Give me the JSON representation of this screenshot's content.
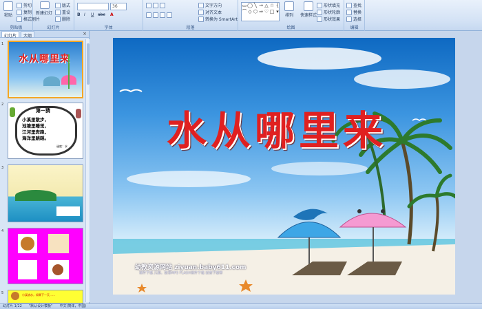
{
  "ribbon": {
    "clipboard": {
      "paste": "粘贴",
      "cut": "剪切",
      "copy": "复制",
      "format_painter": "格式刷",
      "label": "剪贴板"
    },
    "slides": {
      "new_slide": "新建幻灯片",
      "layout": "版式",
      "reset": "重设",
      "delete": "删除",
      "label": "幻灯片"
    },
    "font": {
      "font_name": "",
      "font_size": "36",
      "label": "字体"
    },
    "paragraph": {
      "text_direction": "文字方向",
      "align_text": "对齐文本",
      "smartart": "转换为 SmartArt",
      "label": "段落"
    },
    "drawing": {
      "arrange": "排列",
      "quick_styles": "快速样式",
      "fill": "形状填充",
      "outline": "形状轮廓",
      "effects": "形状效果",
      "label": "绘图"
    },
    "editing": {
      "find": "查找",
      "replace": "替换",
      "select": "选择",
      "label": "编辑"
    }
  },
  "panel": {
    "tabs": [
      "幻灯片",
      "大纲"
    ],
    "close": "×",
    "thumbs": [
      {
        "num": "1",
        "text": "水从哪里来"
      },
      {
        "num": "2",
        "text": "第一猜",
        "lines": [
          "小溪里散步，",
          "池塘里睡觉，",
          "江河里奔跑，",
          "海洋里跳蹈。"
        ],
        "answer": "谜底：水"
      },
      {
        "num": "3",
        "text": ""
      },
      {
        "num": "4",
        "text": ""
      },
      {
        "num": "5",
        "text": "小溪流水，如果下一天……"
      }
    ]
  },
  "slide": {
    "title": "水从哪里来",
    "site": "幼教资源网站  ziyuan.baby611.com",
    "site_sub": "课件下载  儿歌、故事MP3  FLASH课件下载  试卷下载等"
  },
  "status": {
    "slide": "幻灯片 1/22",
    "theme": "\"默认设计模板\"",
    "lang": "中文(简体，中国)"
  },
  "colors": {
    "title": "#e02020",
    "selection": "#f5a623",
    "magenta": "#ff00ff"
  }
}
